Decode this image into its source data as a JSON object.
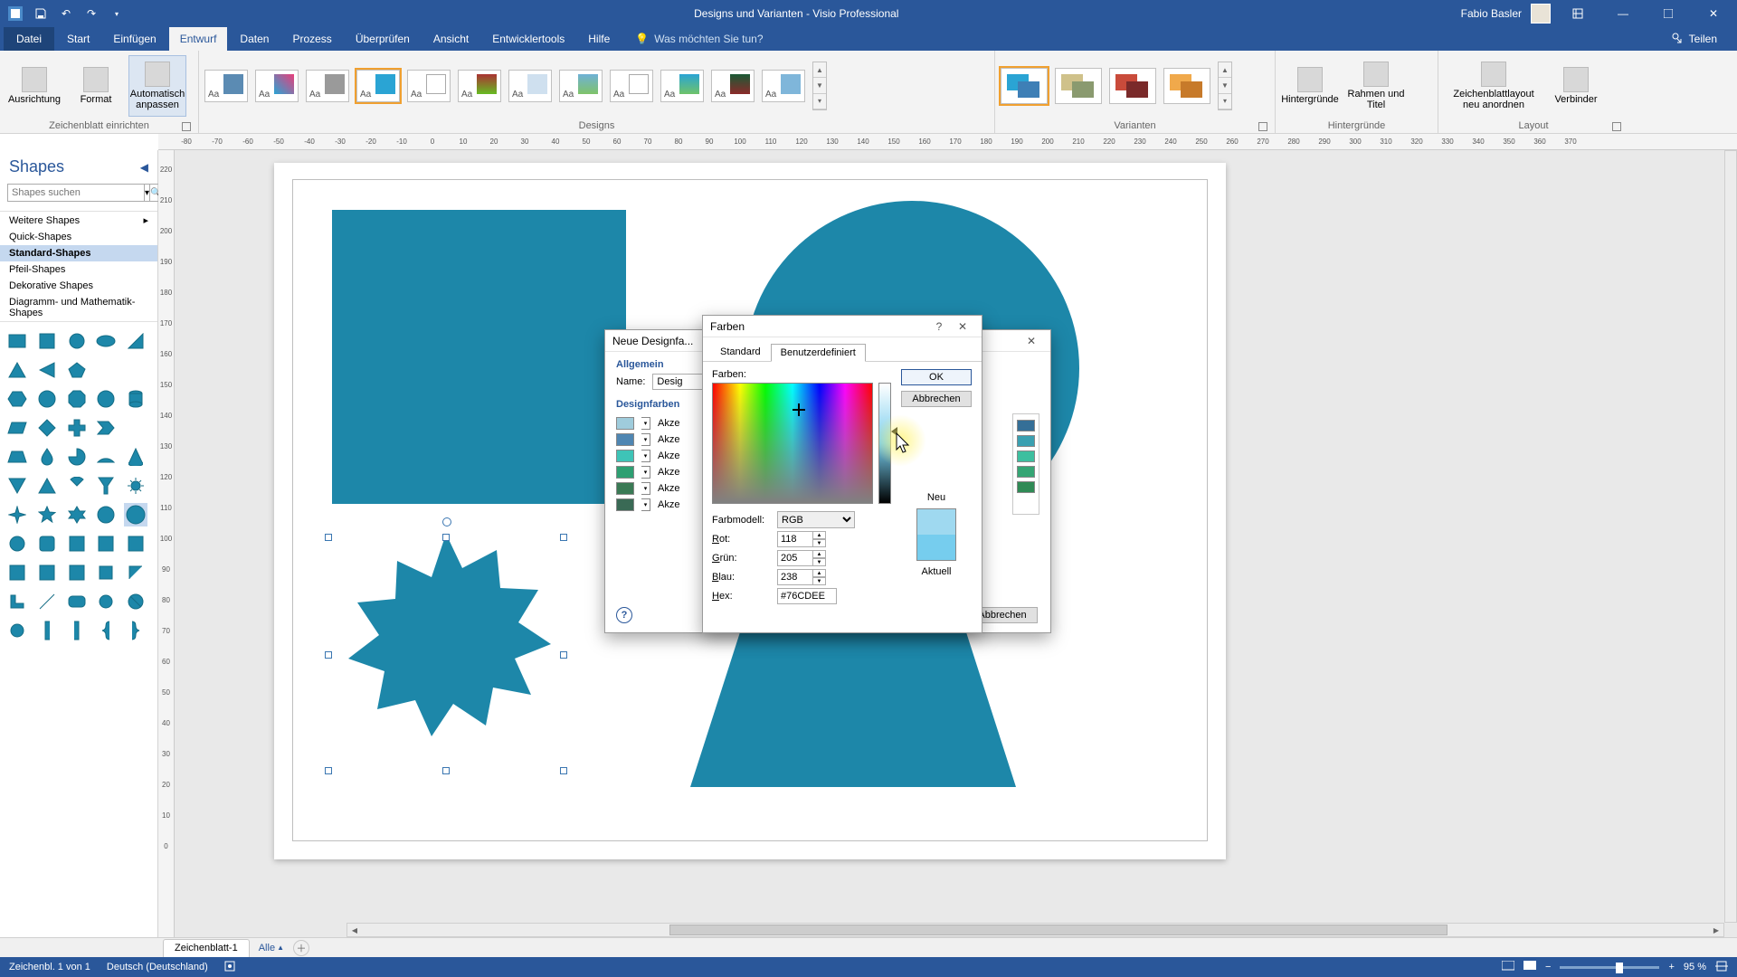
{
  "app": {
    "title": "Designs und Varianten - Visio Professional"
  },
  "user": {
    "name": "Fabio Basler"
  },
  "share_label": "Teilen",
  "menu": {
    "file": "Datei",
    "tabs": [
      "Start",
      "Einfügen",
      "Entwurf",
      "Daten",
      "Prozess",
      "Überprüfen",
      "Ansicht",
      "Entwicklertools",
      "Hilfe"
    ],
    "active": "Entwurf",
    "tellme_placeholder": "Was möchten Sie tun?"
  },
  "ribbon": {
    "group_setup": "Zeichenblatt einrichten",
    "btn_orientation": "Ausrichtung",
    "btn_format": "Format",
    "btn_autofit": "Automatisch anpassen",
    "group_designs": "Designs",
    "group_variants": "Varianten",
    "group_backgrounds": "Hintergründe",
    "btn_backgrounds": "Hintergründe",
    "btn_borders": "Rahmen und Titel",
    "group_layout": "Layout",
    "btn_relayout": "Zeichenblattlayout neu anordnen",
    "btn_connectors": "Verbinder"
  },
  "shapes_pane": {
    "title": "Shapes",
    "search_placeholder": "Shapes suchen",
    "stencils": [
      "Weitere Shapes",
      "Quick-Shapes",
      "Standard-Shapes",
      "Pfeil-Shapes",
      "Dekorative Shapes",
      "Diagramm- und Mathematik-Shapes"
    ],
    "selected_stencil": "Standard-Shapes"
  },
  "sheet": {
    "tab": "Zeichenblatt-1",
    "all": "Alle"
  },
  "status": {
    "page": "Zeichenbl. 1 von 1",
    "lang": "Deutsch (Deutschland)",
    "zoom": "95 %"
  },
  "dlg_design": {
    "title": "Neue Designfa...",
    "section_general": "Allgemein",
    "name_label": "Name:",
    "name_value": "Desig",
    "section_colors": "Designfarben",
    "accent_prefix": "Akze",
    "accent_chips": [
      "#9fccdc",
      "#4f86b2",
      "#3ec4b7",
      "#2e9f72",
      "#3a7a55",
      "#3a6a55"
    ],
    "side_chips": [
      "#356f97",
      "#3aa0b1",
      "#3dbf9f",
      "#35a574",
      "#2f8a55"
    ],
    "cancel": "Abbrechen"
  },
  "dlg_colors": {
    "title": "Farben",
    "tab_standard": "Standard",
    "tab_custom": "Benutzerdefiniert",
    "label_colors": "Farben:",
    "ok": "OK",
    "cancel": "Abbrechen",
    "label_model": "Farbmodell:",
    "model_value": "RGB",
    "label_r": "Rot:",
    "label_g": "Grün:",
    "label_b": "Blau:",
    "label_hex": "Hex:",
    "val_r": "118",
    "val_g": "205",
    "val_b": "238",
    "val_hex": "#76CDEE",
    "label_new": "Neu",
    "label_current": "Aktuell"
  }
}
